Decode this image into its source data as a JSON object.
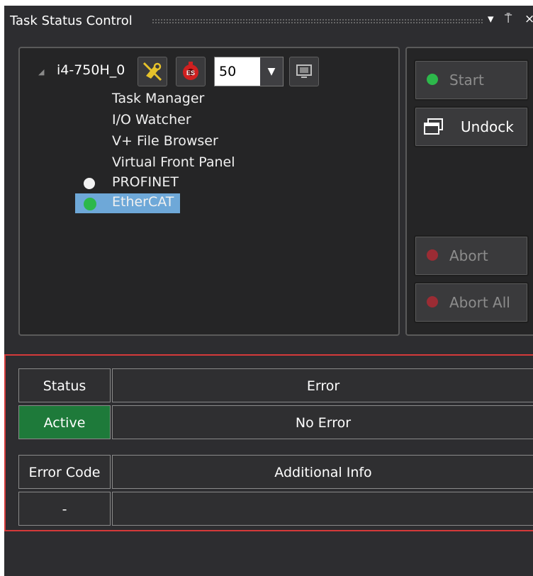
{
  "window": {
    "title": "Task Status Control",
    "menu_icon": "▾",
    "pin_icon": "⍑",
    "close_icon": "×"
  },
  "tree": {
    "device": "i4-750H_0",
    "expander": "◢",
    "speed_value": "50",
    "items": [
      {
        "label": "Task Manager",
        "status": null
      },
      {
        "label": "I/O Watcher",
        "status": null
      },
      {
        "label": "V+ File Browser",
        "status": null
      },
      {
        "label": "Virtual Front Panel",
        "status": null
      },
      {
        "label": "PROFINET",
        "status": "white"
      },
      {
        "label": "EtherCAT",
        "status": "green",
        "selected": true
      }
    ]
  },
  "buttons": {
    "start": "Start",
    "undock": "Undock",
    "abort": "Abort",
    "abort_all": "Abort All"
  },
  "status_table": {
    "headers": [
      "Status",
      "Error"
    ],
    "values": [
      "Active",
      "No Error"
    ],
    "headers2": [
      "Error Code",
      "Additional Info"
    ],
    "values2": [
      "-",
      ""
    ]
  },
  "colors": {
    "panel_bg": "#2d2d30",
    "active_green": "#1e7a3a",
    "indicator_green": "#2db84b",
    "indicator_red": "#9b2c34",
    "selection_blue": "#6ea8d8",
    "border_red": "#d43a3a"
  }
}
